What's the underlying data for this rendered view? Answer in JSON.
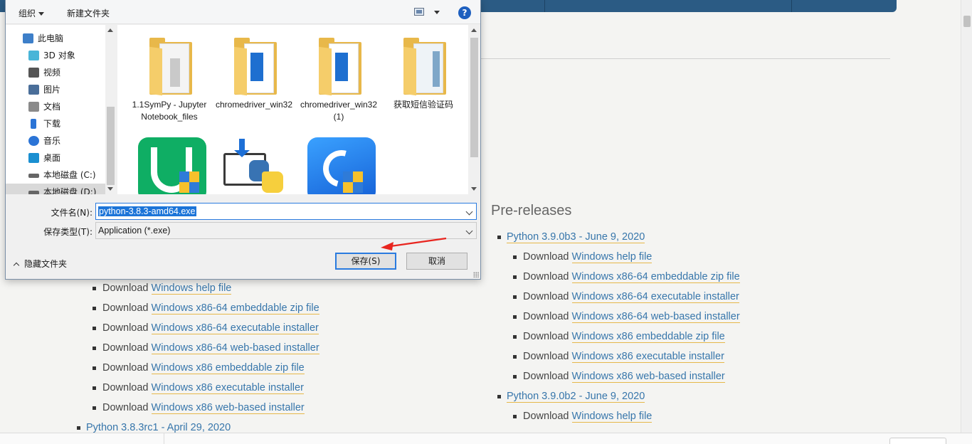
{
  "dialog": {
    "toolbar": {
      "organize": "组织",
      "new_folder": "新建文件夹",
      "help": "?"
    },
    "nav": [
      {
        "label": "此电脑",
        "icon": "computer-icon"
      },
      {
        "label": "3D 对象",
        "icon": "cube-3d-icon"
      },
      {
        "label": "视频",
        "icon": "video-icon"
      },
      {
        "label": "图片",
        "icon": "picture-icon"
      },
      {
        "label": "文档",
        "icon": "document-icon"
      },
      {
        "label": "下载",
        "icon": "download-icon"
      },
      {
        "label": "音乐",
        "icon": "music-icon"
      },
      {
        "label": "桌面",
        "icon": "desktop-icon"
      },
      {
        "label": "本地磁盘 (C:)",
        "icon": "drive-icon"
      },
      {
        "label": "本地磁盘 (D:)",
        "icon": "drive-icon"
      }
    ],
    "files": [
      {
        "name": "1.1SymPy - Jupyter Notebook_files",
        "icon": "folder-icon"
      },
      {
        "name": "chromedriver_win32",
        "icon": "folder-icon"
      },
      {
        "name": "chromedriver_win32 (1)",
        "icon": "folder-icon"
      },
      {
        "name": "获取短信验证码",
        "icon": "folder-icon"
      },
      {
        "name": "",
        "icon": "green-shield-app-icon"
      },
      {
        "name": "",
        "icon": "python-installer-icon"
      },
      {
        "name": "",
        "icon": "blue-app-icon"
      }
    ],
    "filename_label": "文件名(N):",
    "filename_value": "python-3.8.3-amd64.exe",
    "filetype_label": "保存类型(T):",
    "filetype_value": "Application (*.exe)",
    "save_button": "保存(S)",
    "cancel_button": "取消",
    "hide_folders": "隐藏文件夹"
  },
  "page": {
    "prereleases_title": "Pre-releases",
    "download_word": "Download",
    "left_links": [
      "Windows help file",
      "Windows x86-64 embeddable zip file",
      "Windows x86-64 executable installer",
      "Windows x86-64 web-based installer",
      "Windows x86 embeddable zip file",
      "Windows x86 executable installer",
      "Windows x86 web-based installer"
    ],
    "left_next_release": "Python 3.8.3rc1 - April 29, 2020",
    "right_release_1": "Python 3.9.0b3 - June 9, 2020",
    "right_links": [
      "Windows help file",
      "Windows x86-64 embeddable zip file",
      "Windows x86-64 executable installer",
      "Windows x86-64 web-based installer",
      "Windows x86 embeddable zip file",
      "Windows x86 executable installer",
      "Windows x86 web-based installer"
    ],
    "right_release_2": "Python 3.9.0b2 - June 9, 2020",
    "right_release_2_links": [
      "Windows help file"
    ]
  },
  "colors": {
    "link": "#3776ab",
    "underline": "#e6b84a",
    "topbar": "#2b5b84",
    "highlight": "#1c74d8",
    "annotation": "#e8251f"
  }
}
